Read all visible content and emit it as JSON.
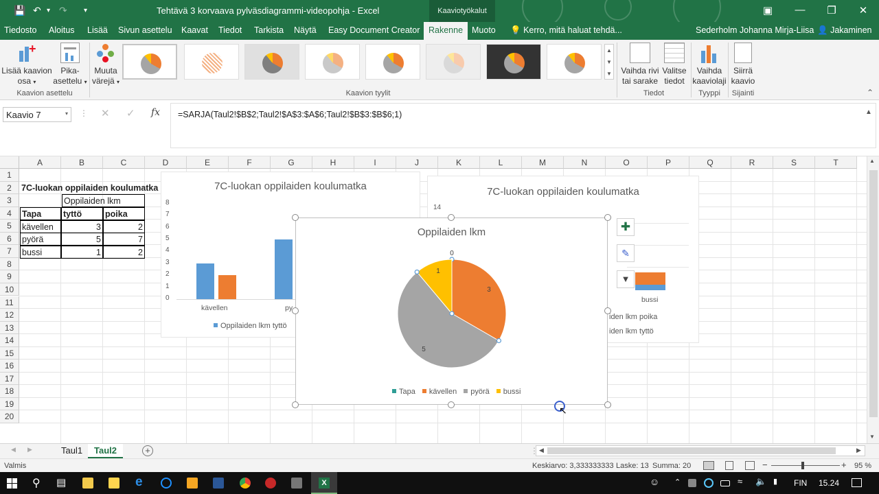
{
  "titlebar": {
    "doc_title": "Tehtävä 3 korvaava pylväsdiagrammi-videopohja - Excel",
    "context_tab": "Kaaviotyökalut"
  },
  "tabs": [
    "Tiedosto",
    "Aloitus",
    "Lisää",
    "Sivun asettelu",
    "Kaavat",
    "Tiedot",
    "Tarkista",
    "Näytä",
    "Easy Document Creator",
    "Rakenne",
    "Muoto"
  ],
  "tell_me": "Kerro, mitä haluat tehdä...",
  "user": "Sederholm Johanna Mirja-Liisa",
  "share": "Jakaminen",
  "ribbon": {
    "add_element": [
      "Lisää kaavion",
      "osa"
    ],
    "quick_layout": [
      "Pika-",
      "asettelu"
    ],
    "change_colors": [
      "Muuta",
      "värejä"
    ],
    "switch_row_col": [
      "Vaihda rivi",
      "tai sarake"
    ],
    "select_data": [
      "Valitse",
      "tiedot"
    ],
    "change_type": [
      "Vaihda",
      "kaaviolaji"
    ],
    "move_chart": [
      "Siirrä",
      "kaavio"
    ],
    "groups": {
      "layouts": "Kaavion asettelu",
      "styles": "Kaavion tyylit",
      "data": "Tiedot",
      "type": "Tyyppi",
      "location": "Sijainti"
    }
  },
  "namebox": "Kaavio 7",
  "formula": "=SARJA(Taul2!$B$2;Taul2!$A$3:$A$6;Taul2!$B$3:$B$6;1)",
  "fx": "fx",
  "columns": [
    "A",
    "B",
    "C",
    "D",
    "E",
    "F",
    "G",
    "H",
    "I",
    "J",
    "K",
    "L",
    "M",
    "N",
    "O",
    "P",
    "Q",
    "R",
    "S",
    "T"
  ],
  "rows": [
    "1",
    "2",
    "3",
    "4",
    "5",
    "6",
    "7",
    "8",
    "9",
    "10",
    "11",
    "12",
    "13",
    "14",
    "15",
    "16",
    "17",
    "18",
    "19",
    "20"
  ],
  "sheet": {
    "a1": "7C-luokan oppilaiden koulumatka",
    "b2": "Oppilaiden lkm",
    "a3": "Tapa",
    "b3": "tyttö",
    "c3": "poika",
    "a4": "kävellen",
    "b4": "3",
    "c4": "2",
    "a5": "pyörä",
    "b5": "5",
    "c5": "7",
    "a6": "bussi",
    "b6": "1",
    "c6": "2"
  },
  "chart_left": {
    "title": "7C-luokan oppilaiden koulumatka",
    "y_ticks": [
      "8",
      "7",
      "6",
      "5",
      "4",
      "3",
      "2",
      "1",
      "0"
    ],
    "cat_1": "kävellen",
    "cat_2_partial": "py",
    "legend": "Oppilaiden lkm tyttö"
  },
  "chart_right": {
    "title": "7C-luokan oppilaiden koulumatka",
    "y_top": "14",
    "cat": "bussi",
    "legend_1": "iden lkm poika",
    "legend_2": "iden lkm tyttö"
  },
  "chart_data": [
    {
      "type": "pie",
      "title": "Oppilaiden lkm",
      "categories": [
        "Tapa",
        "kävellen",
        "pyörä",
        "bussi"
      ],
      "values": [
        0,
        3,
        5,
        1
      ],
      "data_labels": [
        "0",
        "3",
        "5",
        "1"
      ],
      "colors": [
        "#2f9e96",
        "#ed7d31",
        "#a5a5a5",
        "#ffc000"
      ],
      "legend_position": "bottom"
    },
    {
      "type": "bar",
      "title": "7C-luokan oppilaiden koulumatka",
      "categories": [
        "kävellen",
        "pyörä",
        "bussi"
      ],
      "series": [
        {
          "name": "Oppilaiden lkm tyttö",
          "values": [
            3,
            5,
            1
          ]
        },
        {
          "name": "Oppilaiden lkm poika",
          "values": [
            2,
            7,
            2
          ]
        }
      ],
      "ylim": [
        0,
        8
      ]
    }
  ],
  "sheet_tabs": [
    "Taul1",
    "Taul2"
  ],
  "status": {
    "ready": "Valmis",
    "average": "Keskiarvo: 3,333333333",
    "count": "Laske: 13",
    "sum": "Summa: 20",
    "zoom": "95 %"
  },
  "taskbar": {
    "lang": "FIN",
    "time": "15.24"
  },
  "colors": {
    "excel_green": "#217346",
    "series_blue": "#5b9bd5",
    "series_orange": "#ed7d31"
  }
}
